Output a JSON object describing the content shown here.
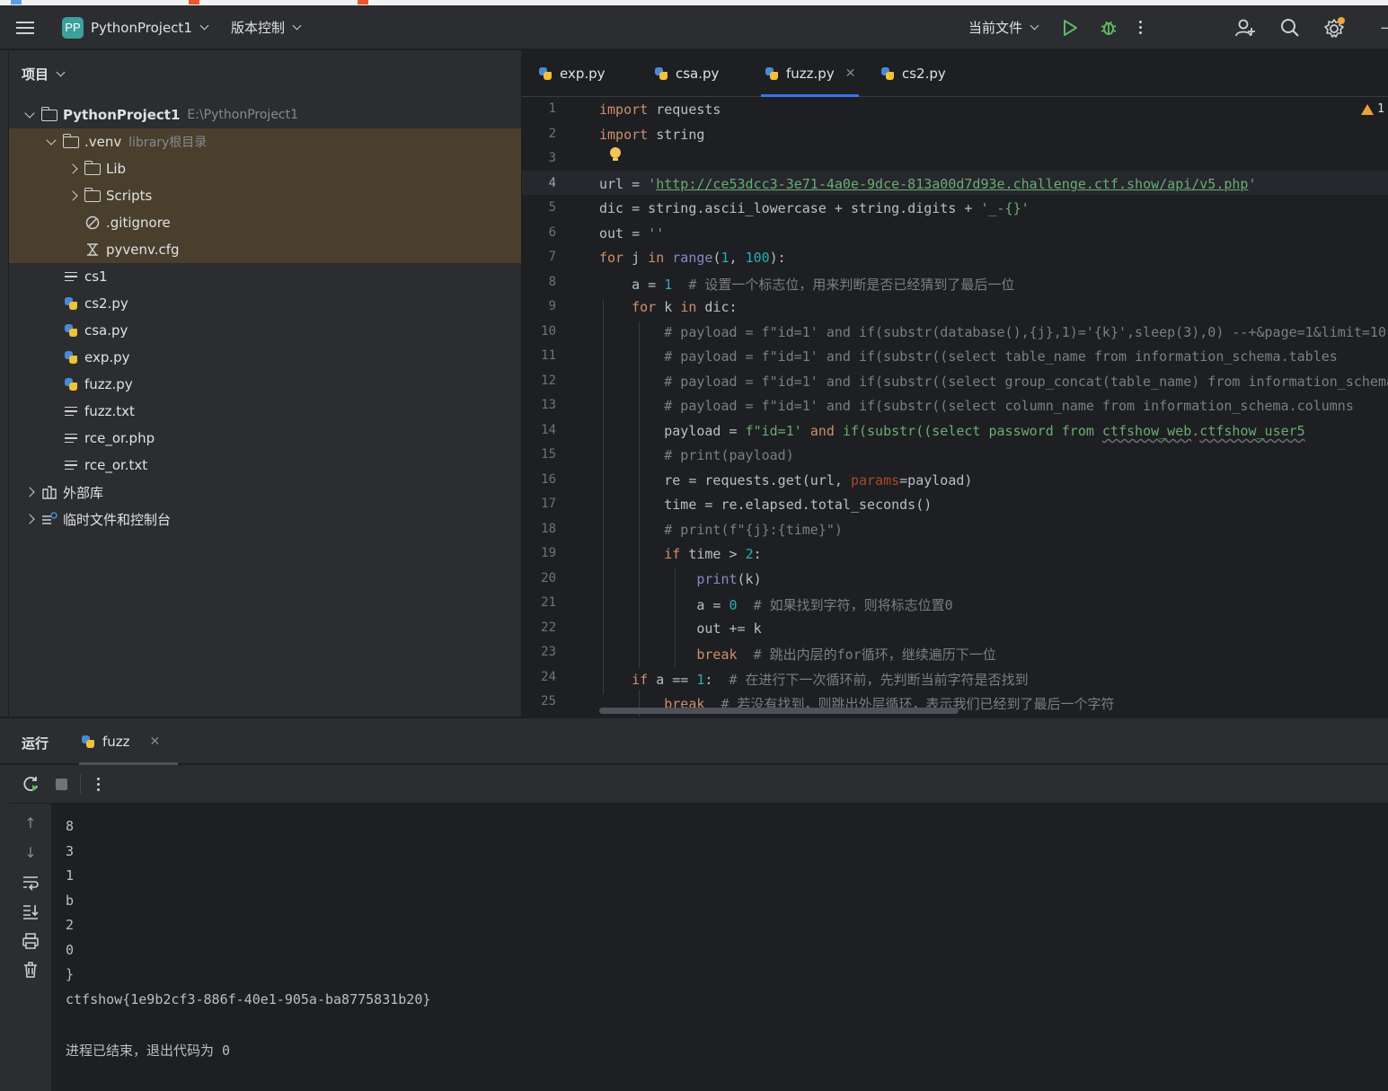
{
  "titlebar": {
    "project_badge": "PP",
    "project_name": "PythonProject1",
    "vcs": "版本控制",
    "run_config": "当前文件"
  },
  "project_panel": {
    "header": "项目",
    "tree": [
      {
        "label": "PythonProject1",
        "hint": "E:\\PythonProject1"
      },
      {
        "label": ".venv",
        "hint": "library根目录"
      },
      {
        "label": "Lib"
      },
      {
        "label": "Scripts"
      },
      {
        "label": ".gitignore"
      },
      {
        "label": "pyvenv.cfg"
      },
      {
        "label": "cs1"
      },
      {
        "label": "cs2.py"
      },
      {
        "label": "csa.py"
      },
      {
        "label": "exp.py"
      },
      {
        "label": "fuzz.py"
      },
      {
        "label": "fuzz.txt"
      },
      {
        "label": "rce_or.php"
      },
      {
        "label": "rce_or.txt"
      },
      {
        "label": "外部库"
      },
      {
        "label": "临时文件和控制台"
      }
    ]
  },
  "editor": {
    "tabs": [
      {
        "label": "exp.py"
      },
      {
        "label": "csa.py"
      },
      {
        "label": "fuzz.py",
        "active": true
      },
      {
        "label": "cs2.py"
      }
    ],
    "warning_count": "1",
    "line_numbers": [
      "1",
      "2",
      "3",
      "4",
      "5",
      "6",
      "7",
      "8",
      "9",
      "10",
      "11",
      "12",
      "13",
      "14",
      "15",
      "16",
      "17",
      "18",
      "19",
      "20",
      "21",
      "22",
      "23",
      "24",
      "25"
    ],
    "url": "http://ce53dcc3-3e71-4a0e-9dce-813a00d7d93e.challenge.ctf.show/api/v5.php",
    "comments": {
      "l8": "# 设置一个标志位，用来判断是否已经猜到了最后一位",
      "l21": "# 如果找到字符，则将标志位置0",
      "l23": "# 跳出内层的for循环，继续遍历下一位",
      "l24": "# 在进行下一次循环前，先判断当前字符是否找到",
      "l25": "# 若没有找到，则跳出外层循环，表示我们已经到了最后一个字符"
    }
  },
  "run_panel": {
    "title": "运行",
    "tab": "fuzz",
    "output": [
      "8",
      "3",
      "1",
      "b",
      "2",
      "0",
      "}",
      "ctfshow{1e9b2cf3-886f-40e1-905a-ba8775831b20}",
      "",
      "进程已结束，退出代码为 0"
    ]
  }
}
